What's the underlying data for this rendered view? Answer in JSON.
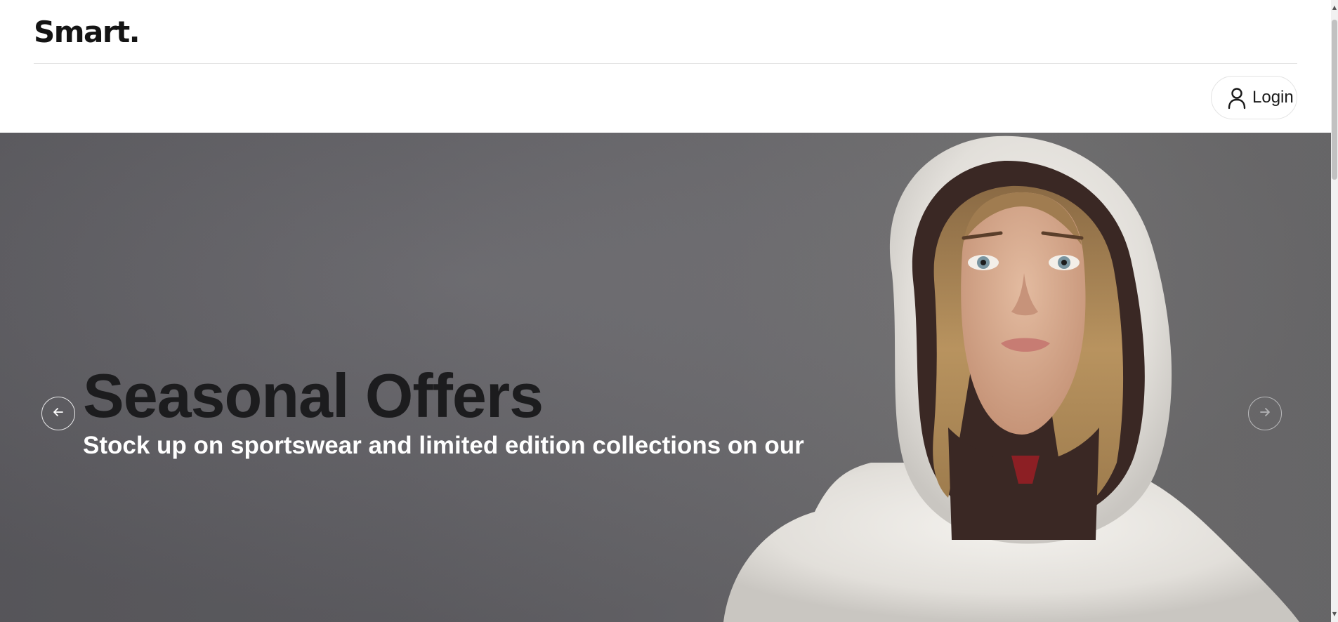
{
  "header": {
    "logo": "Smart."
  },
  "subbar": {
    "login_label": "Login",
    "login_icon": "user-icon"
  },
  "hero": {
    "title": "Seasonal Offers",
    "subtitle": "Stock up on sportswear and limited edition collections on our",
    "prev_icon": "arrow-left-icon",
    "next_icon": "arrow-right-icon"
  },
  "colors": {
    "text": "#161616",
    "hero_bg": "#646367",
    "white": "#ffffff"
  },
  "scrollbar": {
    "up_icon": "scroll-up-icon",
    "down_icon": "scroll-down-icon"
  }
}
